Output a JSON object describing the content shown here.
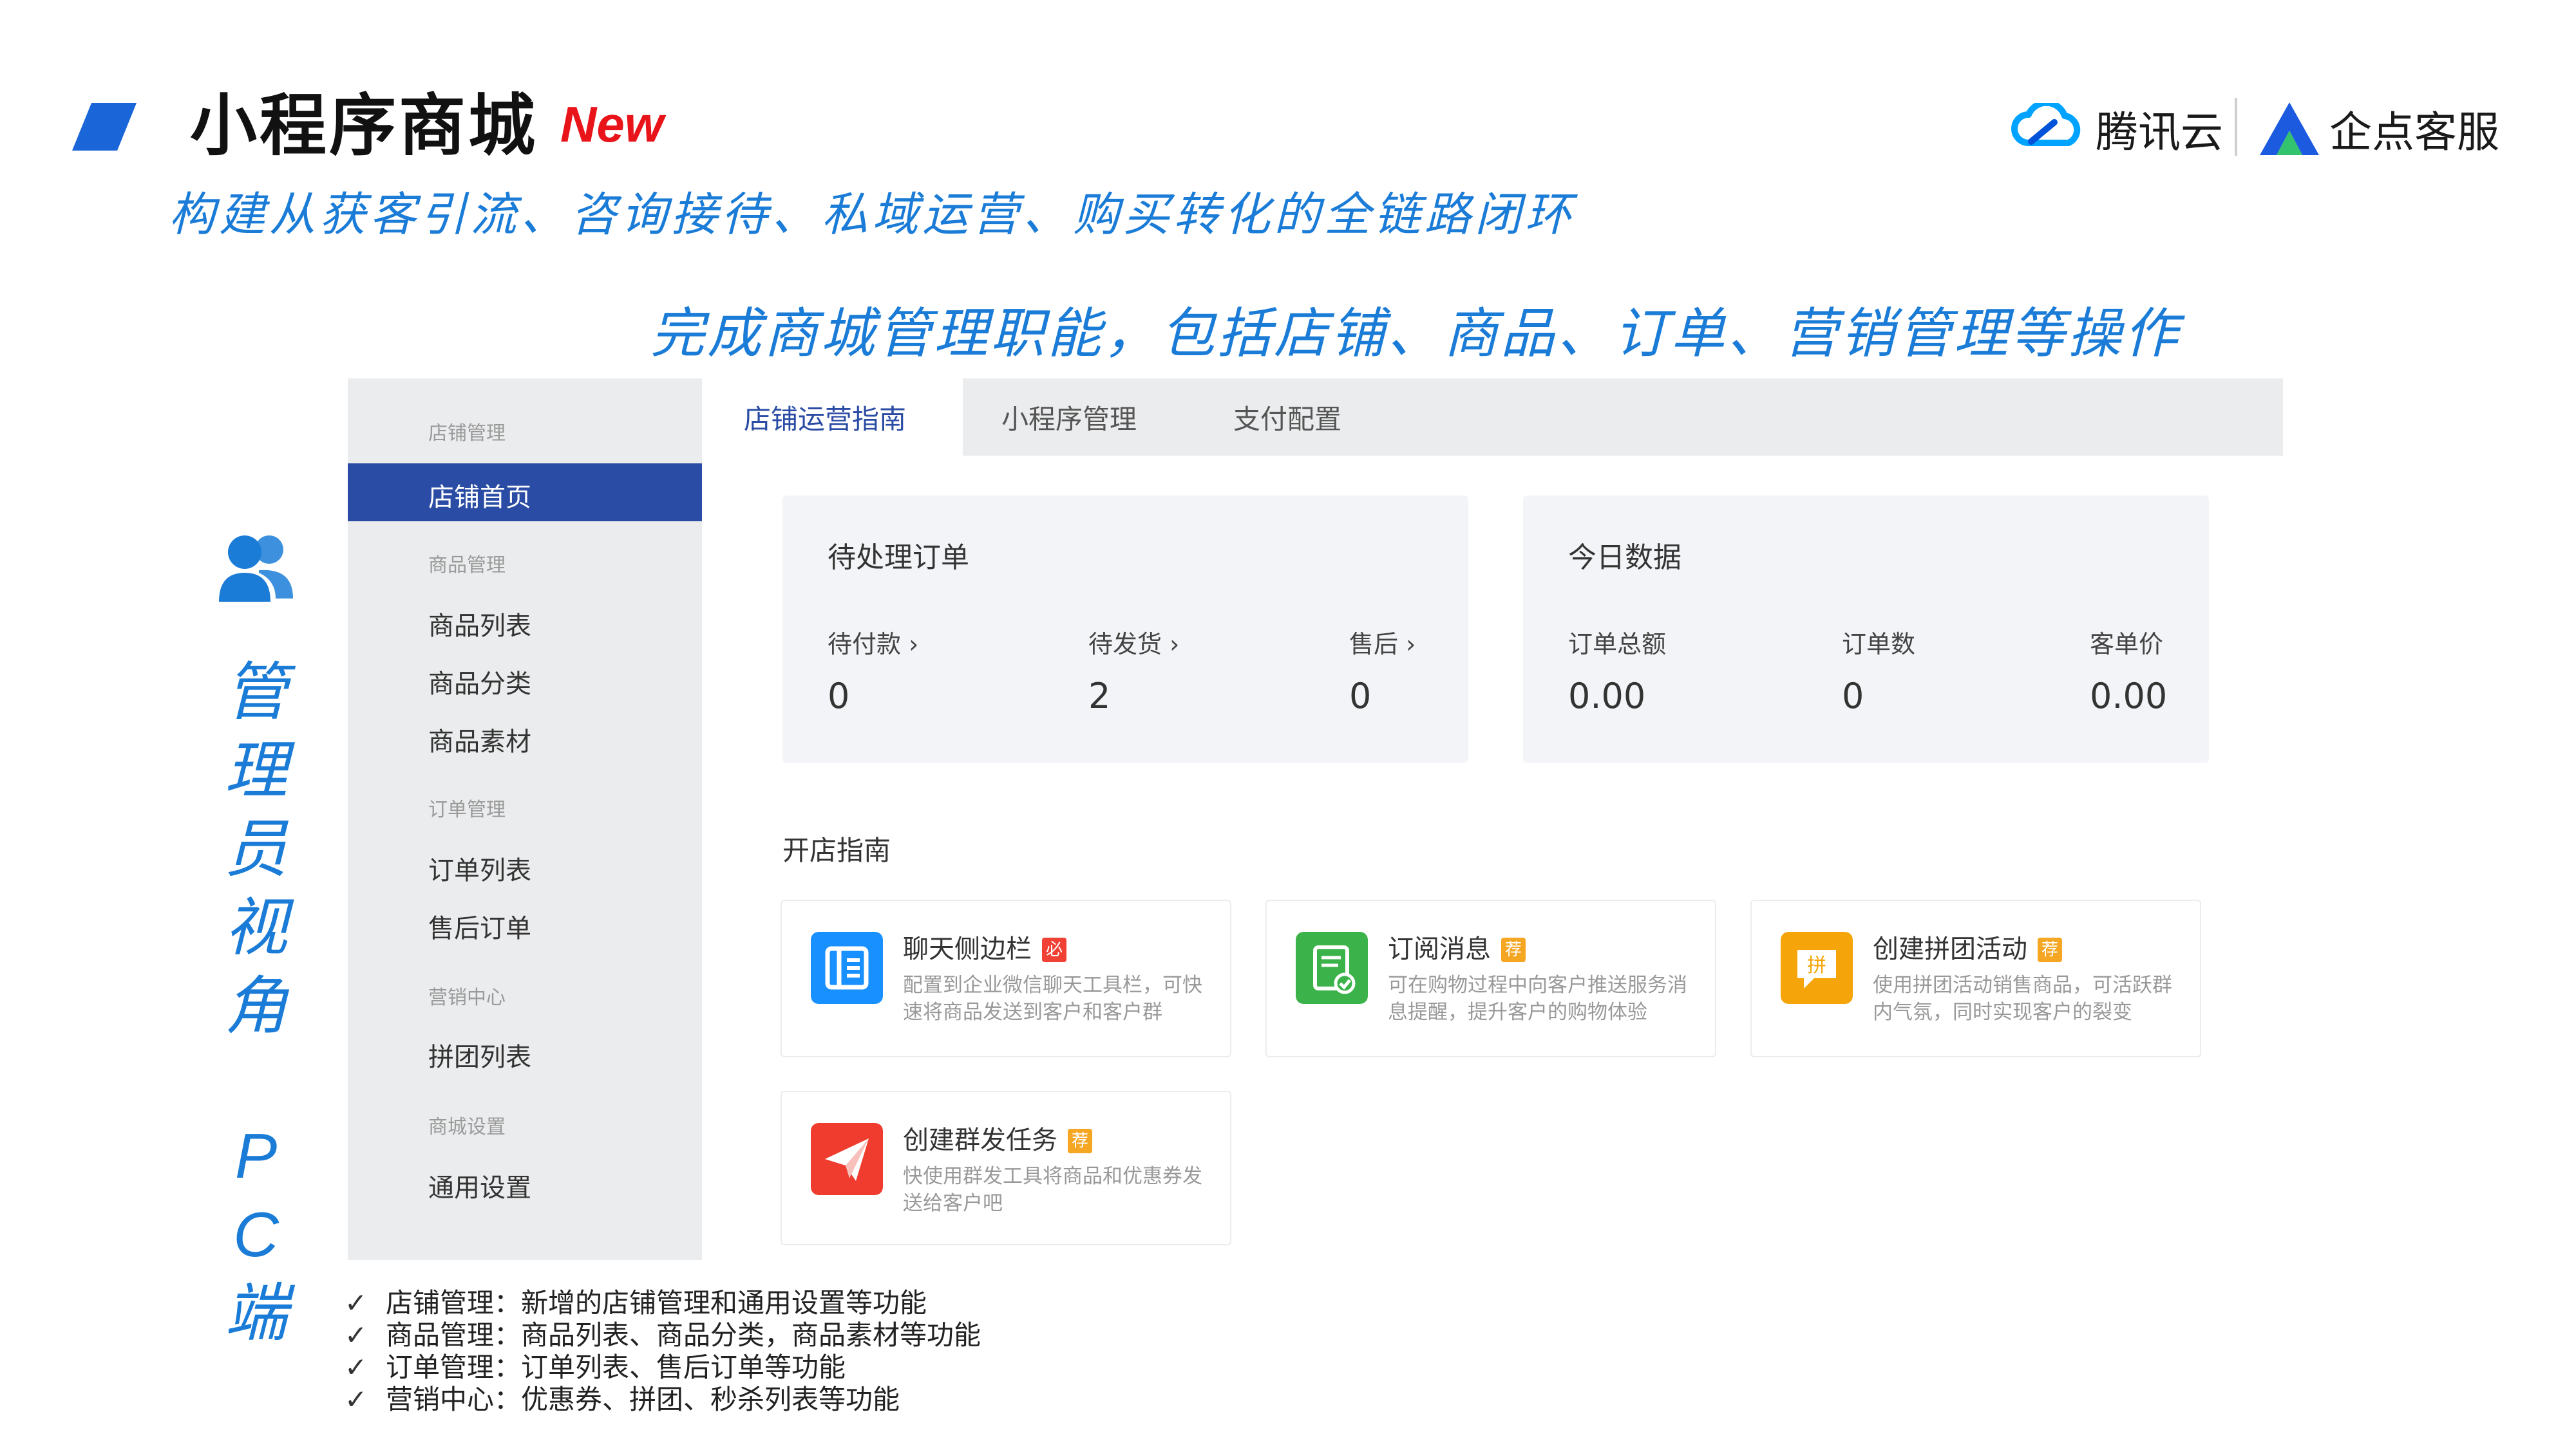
{
  "slide": {
    "title": "小程序商城",
    "badge": "New",
    "subtitle": "构建从获客引流、咨询接待、私域运营、购买转化的全链路闭环",
    "tagline": "完成商城管理职能，包括店铺、商品、订单、营销管理等操作",
    "vertical_label": "管理员视角",
    "vertical_label_chars": [
      "管",
      "理",
      "员",
      "视",
      "角"
    ],
    "vertical_pc_chars": [
      "P",
      "C",
      "端"
    ]
  },
  "logos": {
    "tencent": "腾讯云",
    "qidian": "企点客服"
  },
  "sidebar": {
    "groups": [
      {
        "label": "店铺管理",
        "items": [
          "店铺首页"
        ]
      },
      {
        "label": "商品管理",
        "items": [
          "商品列表",
          "商品分类",
          "商品素材"
        ]
      },
      {
        "label": "订单管理",
        "items": [
          "订单列表",
          "售后订单"
        ]
      },
      {
        "label": "营销中心",
        "items": [
          "拼团列表"
        ]
      },
      {
        "label": "商城设置",
        "items": [
          "通用设置"
        ]
      }
    ],
    "active": "店铺首页"
  },
  "tabs": [
    "店铺运营指南",
    "小程序管理",
    "支付配置"
  ],
  "pending_orders": {
    "title": "待处理订单",
    "stats": [
      {
        "label": "待付款 ›",
        "value": "0"
      },
      {
        "label": "待发货 ›",
        "value": "2"
      },
      {
        "label": "售后 ›",
        "value": "0"
      }
    ]
  },
  "today_data": {
    "title": "今日数据",
    "stats": [
      {
        "label": "订单总额",
        "value": "0.00"
      },
      {
        "label": "订单数",
        "value": "0"
      },
      {
        "label": "客单价",
        "value": "0.00"
      }
    ]
  },
  "guide": {
    "title": "开店指南",
    "cards": [
      {
        "name": "聊天侧边栏",
        "badge": "必",
        "desc": "配置到企业微信聊天工具栏，可快速将商品发送到客户和客户群",
        "icon": "sidebar-icon",
        "color": "#1890ff",
        "badge_color": "#f04134"
      },
      {
        "name": "订阅消息",
        "badge": "荐",
        "desc": "可在购物过程中向客户推送服务消息提醒，提升客户的购物体验",
        "icon": "subscribe-icon",
        "color": "#3bb34a",
        "badge_color": "#f5a623"
      },
      {
        "name": "创建拼团活动",
        "badge": "荐",
        "desc": "使用拼团活动销售商品，可活跃群内气氛，同时实现客户的裂变",
        "icon": "group-buy-icon",
        "color": "#f5a50a",
        "badge_color": "#f5a623"
      },
      {
        "name": "创建群发任务",
        "badge": "荐",
        "desc": "快使用群发工具将商品和优惠券发送给客户吧",
        "icon": "broadcast-icon",
        "color": "#f03c2e",
        "badge_color": "#f5a623"
      }
    ]
  },
  "bullets": [
    "店铺管理：新增的店铺管理和通用设置等功能",
    "商品管理：商品列表、商品分类，商品素材等功能",
    "订单管理：订单列表、售后订单等功能",
    "营销中心：优惠券、拼团、秒杀列表等功能"
  ],
  "check_mark": "✓"
}
